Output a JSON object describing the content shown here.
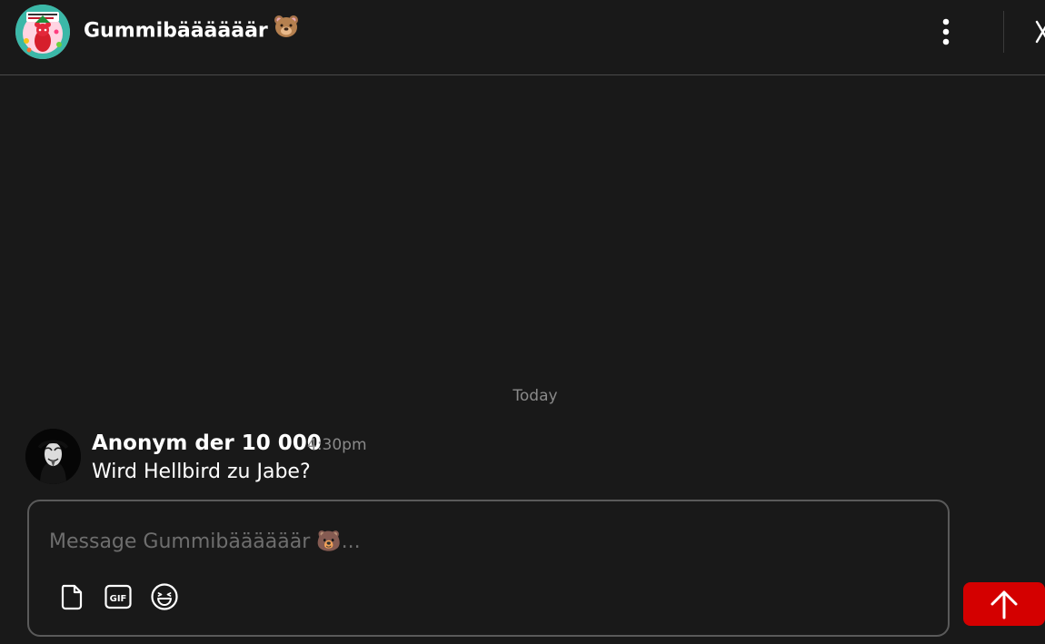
{
  "header": {
    "channel_title": "Gummibäääääär",
    "title_emoji": "bear-face-icon",
    "avatar": "gummy-bear-channel-avatar",
    "menu_icon": "more-vertical-icon",
    "close_icon": "close-icon"
  },
  "feed": {
    "date_separator": "Today",
    "messages": [
      {
        "author": "Anonym der 10 000",
        "time": "4:30pm",
        "text": "Wird Hellbird zu Jabe?",
        "avatar": "anonymous-mask-avatar"
      }
    ]
  },
  "composer": {
    "placeholder": "Message Gummibäääääär 🐻...",
    "value": "",
    "tools": [
      "file-icon",
      "gif-icon",
      "emoji-icon"
    ]
  },
  "scroll_top": {
    "icon": "arrow-up-icon"
  },
  "colors": {
    "background": "#191919",
    "border": "#4a4a4a",
    "muted_text": "#8a8a8a",
    "placeholder_text": "#6e6e6e",
    "accent_red": "#d40000"
  }
}
